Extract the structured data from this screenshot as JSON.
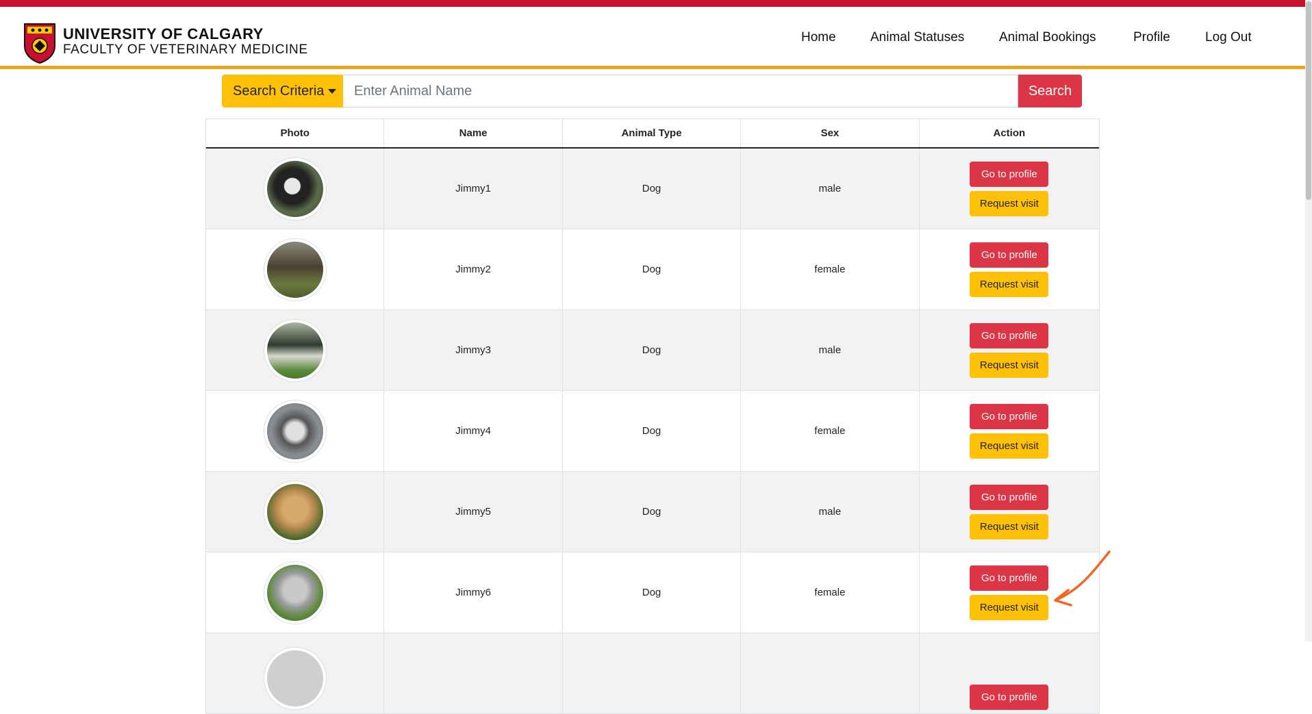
{
  "header": {
    "university": "UNIVERSITY OF CALGARY",
    "faculty": "FACULTY OF VETERINARY MEDICINE",
    "nav": [
      "Home",
      "Animal Statuses",
      "Animal Bookings",
      "Profile",
      "Log Out"
    ]
  },
  "search": {
    "criteria_label": "Search Criteria",
    "placeholder": "Enter Animal Name",
    "button_label": "Search"
  },
  "table": {
    "headers": [
      "Photo",
      "Name",
      "Animal Type",
      "Sex",
      "Action"
    ],
    "actions": {
      "profile": "Go to profile",
      "visit": "Request visit"
    },
    "rows": [
      {
        "name": "Jimmy1",
        "type": "Dog",
        "sex": "male"
      },
      {
        "name": "Jimmy2",
        "type": "Dog",
        "sex": "female"
      },
      {
        "name": "Jimmy3",
        "type": "Dog",
        "sex": "male"
      },
      {
        "name": "Jimmy4",
        "type": "Dog",
        "sex": "female"
      },
      {
        "name": "Jimmy5",
        "type": "Dog",
        "sex": "male"
      },
      {
        "name": "Jimmy6",
        "type": "Dog",
        "sex": "female"
      }
    ]
  },
  "colors": {
    "brand_red": "#c8102e",
    "brand_gold": "#e8a624",
    "danger": "#dc3545",
    "warning": "#ffc107"
  }
}
